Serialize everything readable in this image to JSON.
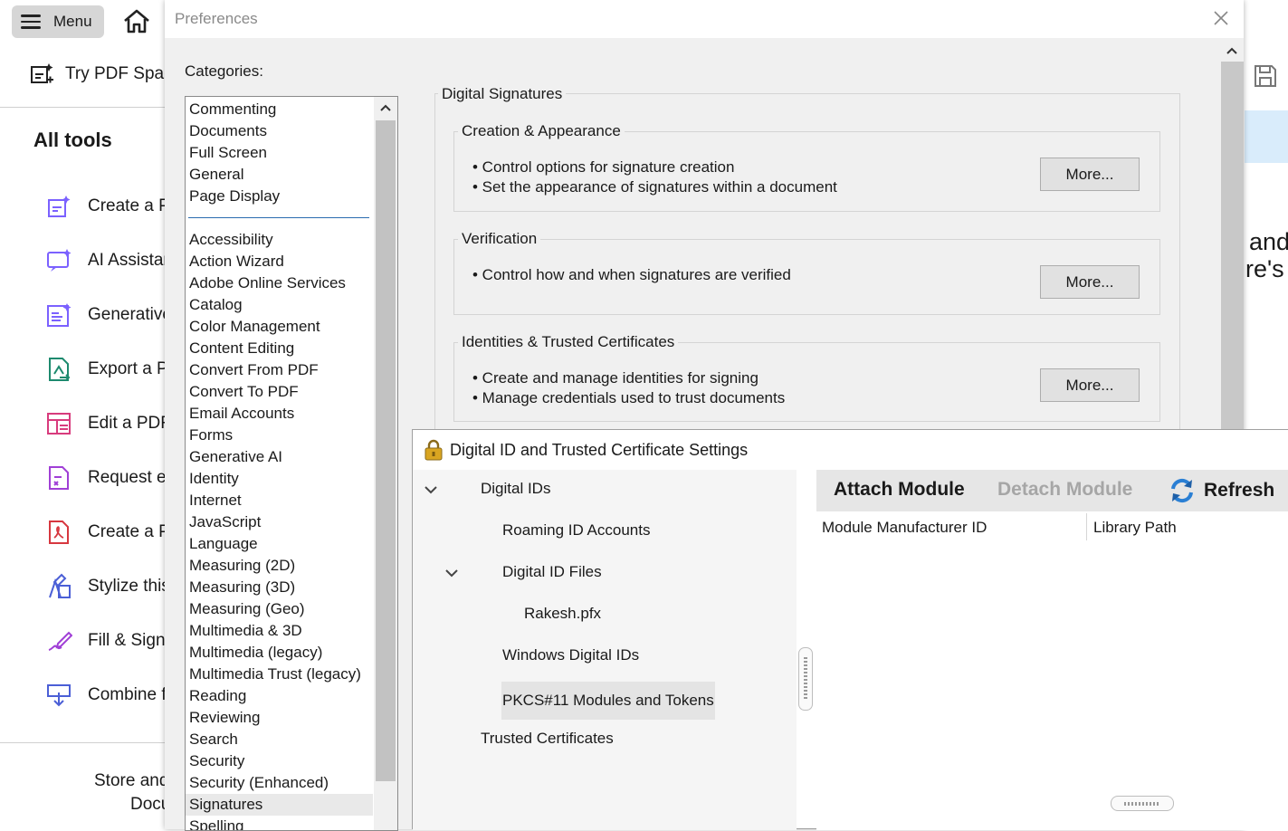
{
  "app": {
    "menu_label": "Menu",
    "try_pdf_label": "Try PDF Spac",
    "all_tools_label": "All tools",
    "tools": [
      {
        "label": "Create a P",
        "icon": "create-pdf-icon",
        "color": "#7b61ff"
      },
      {
        "label": "AI Assistar",
        "icon": "ai-assistant-icon",
        "color": "#7b61ff"
      },
      {
        "label": "Generative",
        "icon": "generative-icon",
        "color": "#7b61ff"
      },
      {
        "label": "Export a P",
        "icon": "export-pdf-icon",
        "color": "#1d8a6e"
      },
      {
        "label": "Edit a PDF",
        "icon": "edit-pdf-icon",
        "color": "#d83b7d"
      },
      {
        "label": "Request e",
        "icon": "request-esign-icon",
        "color": "#a03fd6"
      },
      {
        "label": "Create a P",
        "icon": "create-pdf-red-icon",
        "color": "#d7373f"
      },
      {
        "label": "Stylize this",
        "icon": "stylize-icon",
        "color": "#4b5fd6"
      },
      {
        "label": "Fill & Sign",
        "icon": "fill-sign-icon",
        "color": "#a03fd6"
      },
      {
        "label": "Combine f",
        "icon": "combine-files-icon",
        "color": "#4b5fd6"
      }
    ],
    "store_text_line1": "Store and",
    "store_text_line2": "Docu",
    "right_text_line1": "and",
    "right_text_line2": "re's"
  },
  "prefs": {
    "title": "Preferences",
    "categories_label": "Categories:",
    "top_categories": [
      "Commenting",
      "Documents",
      "Full Screen",
      "General",
      "Page Display"
    ],
    "categories": [
      "Accessibility",
      "Action Wizard",
      "Adobe Online Services",
      "Catalog",
      "Color Management",
      "Content Editing",
      "Convert From PDF",
      "Convert To PDF",
      "Email Accounts",
      "Forms",
      "Generative AI",
      "Identity",
      "Internet",
      "JavaScript",
      "Language",
      "Measuring (2D)",
      "Measuring (3D)",
      "Measuring (Geo)",
      "Multimedia & 3D",
      "Multimedia (legacy)",
      "Multimedia Trust (legacy)",
      "Reading",
      "Reviewing",
      "Search",
      "Security",
      "Security (Enhanced)",
      "Signatures",
      "Spelling"
    ],
    "selected_category": "Signatures",
    "section_title": "Digital Signatures",
    "groups": [
      {
        "title": "Creation & Appearance",
        "bullets": [
          "• Control options for signature creation",
          "• Set the appearance of signatures within a document"
        ],
        "button": "More..."
      },
      {
        "title": "Verification",
        "bullets": [
          "• Control how and when signatures are verified"
        ],
        "button": "More..."
      },
      {
        "title": "Identities & Trusted Certificates",
        "bullets": [
          "• Create and manage identities for signing",
          "• Manage credentials used to trust documents"
        ],
        "button": "More..."
      }
    ]
  },
  "digital_id": {
    "title": "Digital ID and Trusted Certificate Settings",
    "tree": {
      "digital_ids": "Digital IDs",
      "roaming": "Roaming ID Accounts",
      "id_files": "Digital ID Files",
      "rakesh": "Rakesh.pfx",
      "windows": "Windows Digital IDs",
      "pkcs": "PKCS#11 Modules and Tokens",
      "trusted": "Trusted Certificates"
    },
    "toolbar": {
      "attach": "Attach Module",
      "detach": "Detach Module",
      "refresh": "Refresh"
    },
    "columns": [
      "Module Manufacturer ID",
      "Library Path"
    ]
  }
}
